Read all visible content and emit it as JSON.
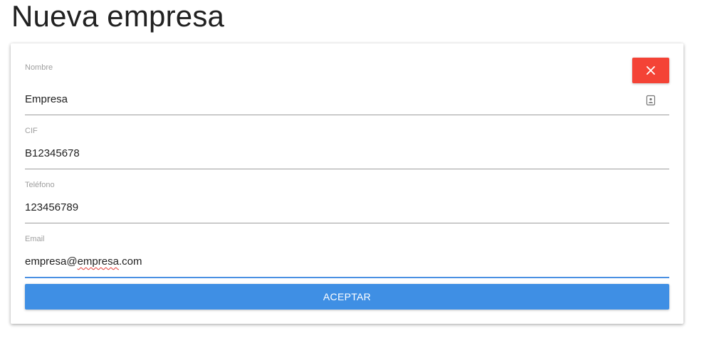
{
  "page": {
    "title": "Nueva empresa"
  },
  "form": {
    "fields": [
      {
        "label": "Nombre",
        "value": "Empresa"
      },
      {
        "label": "CIF",
        "value": "B12345678"
      },
      {
        "label": "Teléfono",
        "value": "123456789"
      },
      {
        "label": "Email",
        "value_prefix": "empresa@",
        "value_flagged": "empresa",
        "value_suffix": ".com"
      }
    ],
    "submit_label": "ACEPTAR"
  },
  "icons": {
    "close": "close-icon",
    "contact_card": "contact-card-icon"
  },
  "colors": {
    "close_button": "#f44336",
    "accept_button": "#3f8fe4",
    "active_underline": "#4a90e2"
  }
}
